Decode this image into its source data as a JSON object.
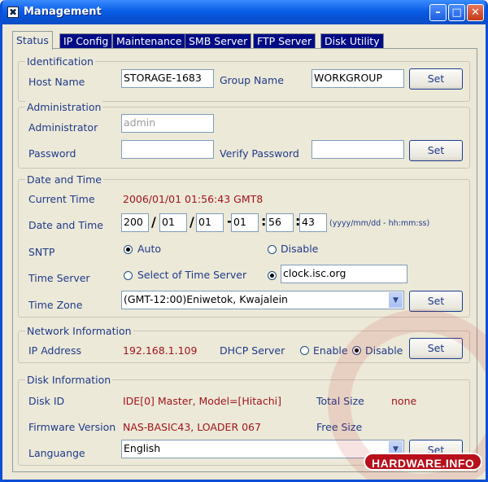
{
  "window": {
    "title": "Management"
  },
  "tabs": [
    "Status",
    "IP Config",
    "Maintenance",
    "SMB Server",
    "FTP Server",
    "Disk Utility"
  ],
  "identification": {
    "legend": "Identification",
    "host_name_label": "Host Name",
    "host_name": "STORAGE-1683",
    "group_name_label": "Group Name",
    "group_name": "WORKGROUP",
    "set": "Set"
  },
  "administration": {
    "legend": "Administration",
    "administrator_label": "Administrator",
    "administrator": "admin",
    "password_label": "Password",
    "verify_label": "Verify Password",
    "set": "Set"
  },
  "datetime": {
    "legend": "Date and Time",
    "current_time_label": "Current Time",
    "current_time": "2006/01/01 01:56:43 GMT8",
    "date_time_label": "Date and Time",
    "year": "200",
    "month": "01",
    "day": "01",
    "hour": "01",
    "minute": "56",
    "second": "43",
    "format_hint": "(yyyy/mm/dd - hh:mm:ss)",
    "sntp_label": "SNTP",
    "sntp_auto": "Auto",
    "sntp_disable": "Disable",
    "time_server_label": "Time Server",
    "time_server_select": "Select of Time Server",
    "time_server": "clock.isc.org",
    "time_zone_label": "Time Zone",
    "time_zone": "(GMT-12:00)Eniwetok, Kwajalein",
    "set": "Set"
  },
  "network": {
    "legend": "Network Information",
    "ip_label": "IP Address",
    "ip": "192.168.1.109",
    "dhcp_label": "DHCP Server",
    "dhcp_enable": "Enable",
    "dhcp_disable": "Disable",
    "set": "Set"
  },
  "disk": {
    "legend": "Disk Information",
    "disk_id_label": "Disk ID",
    "disk_id": "IDE[0] Master, Model=[Hitachi]",
    "total_size_label": "Total Size",
    "total_size": "none",
    "firmware_label": "Firmware Version",
    "firmware": "NAS-BASIC43, LOADER 067",
    "free_size_label": "Free Size",
    "language_label": "Languange",
    "language": "English",
    "set": "Set"
  },
  "watermark": {
    "text": "HARDWARE.INFO"
  }
}
